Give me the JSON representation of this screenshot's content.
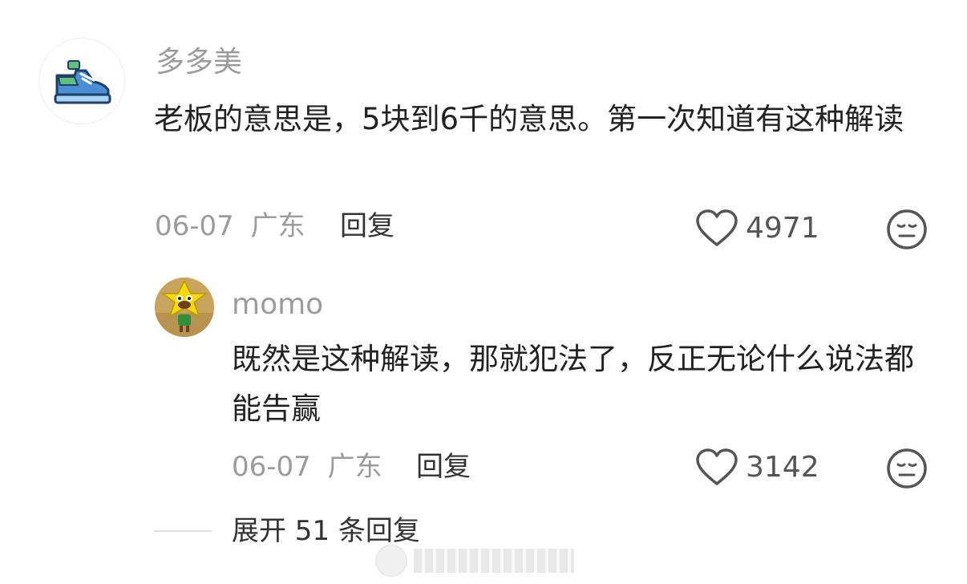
{
  "comments": {
    "main": {
      "username": "多多美",
      "text": "老板的意思是，5块到6千的意思。第一次知道有这种解读",
      "date": "06-07",
      "location": "广东",
      "reply_label": "回复",
      "likes": "4971",
      "avatar_icon": "sneaker-icon"
    },
    "reply": {
      "username": "momo",
      "text": "既然是这种解读，那就犯法了，反正无论什么说法都能告赢",
      "date": "06-07",
      "location": "广东",
      "reply_label": "回复",
      "likes": "3142",
      "avatar_icon": "cartoon-character-avatar"
    }
  },
  "expand_replies": {
    "label": "展开 51 条回复"
  },
  "colors": {
    "muted_text": "#9b9b9b",
    "body_text": "#222222",
    "icon_gray": "#555555",
    "sneaker_blue": "#4a8fd6",
    "sneaker_green": "#5ec27a"
  }
}
